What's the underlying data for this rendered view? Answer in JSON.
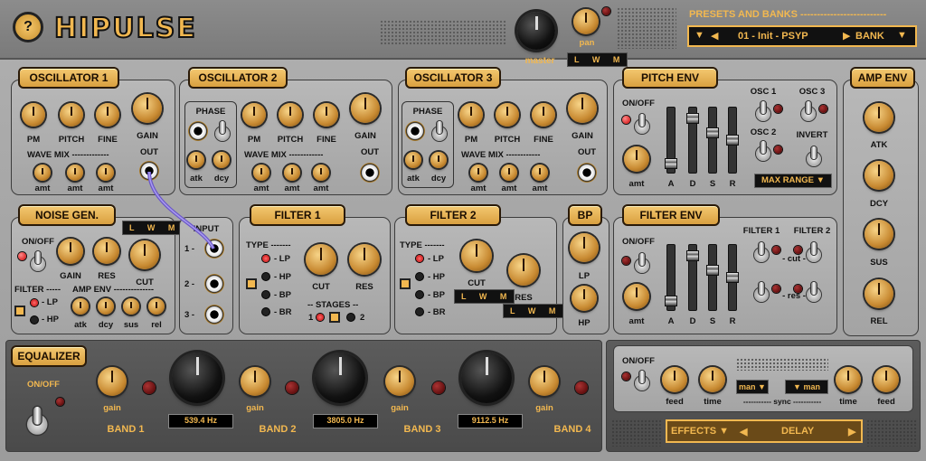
{
  "app": {
    "help": "?",
    "title": "HIPULSE"
  },
  "header": {
    "master": "master",
    "pan": "pan",
    "lwm": "L W M",
    "presets_title": "PRESETS AND BANKS --------------------------",
    "preset_name": "01 - Init - PSYP",
    "bank": "BANK"
  },
  "osc1": {
    "title": "OSCILLATOR 1",
    "pm": "PM",
    "pitch": "PITCH",
    "fine": "FINE",
    "gain": "GAIN",
    "out": "OUT",
    "wavemix": "WAVE MIX -------------",
    "amt": "amt"
  },
  "osc2": {
    "title": "OSCILLATOR 2",
    "phase": "PHASE",
    "atk": "atk",
    "dcy": "dcy",
    "pm": "PM",
    "pitch": "PITCH",
    "fine": "FINE",
    "gain": "GAIN",
    "out": "OUT",
    "wavemix": "WAVE MIX ------------",
    "amt": "amt"
  },
  "osc3": {
    "title": "OSCILLATOR 3",
    "phase": "PHASE",
    "atk": "atk",
    "dcy": "dcy",
    "pm": "PM",
    "pitch": "PITCH",
    "fine": "FINE",
    "gain": "GAIN",
    "out": "OUT",
    "wavemix": "WAVE MIX ------------",
    "amt": "amt"
  },
  "pitchenv": {
    "title": "PITCH ENV",
    "onoff": "ON/OFF",
    "amt": "amt",
    "a": "A",
    "d": "D",
    "s": "S",
    "r": "R",
    "osc1": "OSC 1",
    "osc2": "OSC 2",
    "osc3": "OSC 3",
    "invert": "INVERT",
    "maxrange": "MAX RANGE ▼"
  },
  "ampenv": {
    "title": "AMP ENV",
    "atk": "ATK",
    "dcy": "DCY",
    "sus": "SUS",
    "rel": "REL"
  },
  "noise": {
    "title": "NOISE GEN.",
    "lwm": "L W M",
    "onoff": "ON/OFF",
    "gain": "GAIN",
    "res": "RES",
    "cut": "CUT",
    "filter": "FILTER -----",
    "ampenv": "AMP ENV --------------",
    "lp": "- LP",
    "hp": "- HP",
    "atk": "atk",
    "dcy": "dcy",
    "sus": "sus",
    "rel": "rel"
  },
  "input": {
    "title": "INPUT",
    "i1": "1 -",
    "i2": "2 -",
    "i3": "3 -"
  },
  "filter1": {
    "title": "FILTER 1",
    "type": "TYPE -------",
    "lp": "- LP",
    "hp": "- HP",
    "bp": "- BP",
    "br": "- BR",
    "cut": "CUT",
    "res": "RES",
    "stages": "-- STAGES --",
    "s1": "1",
    "s2": "2"
  },
  "filter2": {
    "title": "FILTER 2",
    "type": "TYPE -------",
    "lp": "- LP",
    "hp": "- HP",
    "bp": "- BP",
    "br": "- BR",
    "cut": "CUT",
    "res": "RES",
    "lwm": "L W M"
  },
  "bp": {
    "title": "BP",
    "lp": "LP",
    "hp": "HP"
  },
  "filterenv": {
    "title": "FILTER ENV",
    "onoff": "ON/OFF",
    "amt": "amt",
    "a": "A",
    "d": "D",
    "s": "S",
    "r": "R",
    "f1": "FILTER 1",
    "f2": "FILTER 2",
    "cut": "- cut -",
    "res": "- res -"
  },
  "eq": {
    "title": "EQUALIZER",
    "onoff": "ON/OFF",
    "gain": "gain",
    "band1": "BAND 1",
    "band2": "BAND 2",
    "band3": "BAND 3",
    "band4": "BAND 4",
    "f1": "539.4 Hz",
    "f2": "3805.0 Hz",
    "f3": "9112.5 Hz"
  },
  "effects": {
    "onoff": "ON/OFF",
    "feed": "feed",
    "time": "time",
    "sync": "----------- sync -----------",
    "man1": "man",
    "man2": "man",
    "effects_label": "EFFECTS ▼",
    "effect": "DELAY"
  }
}
